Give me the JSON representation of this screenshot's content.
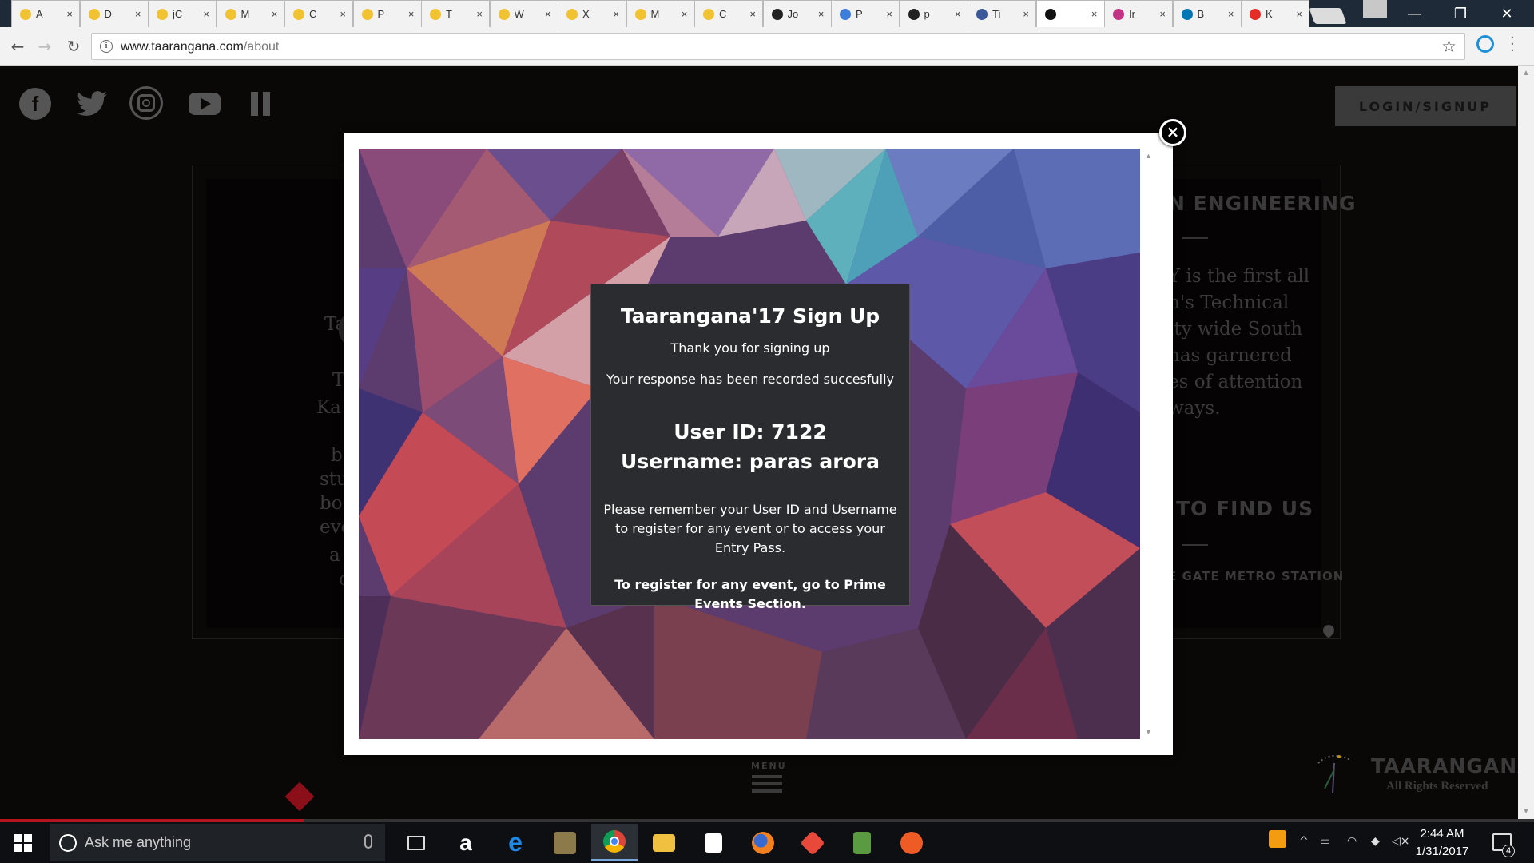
{
  "browser": {
    "tabs": [
      {
        "title": "A",
        "favicon": "chrome-circle-icon",
        "color": "#f1c232"
      },
      {
        "title": "D",
        "favicon": "chrome-circle-icon",
        "color": "#f1c232"
      },
      {
        "title": "jC",
        "favicon": "chrome-circle-icon",
        "color": "#f1c232"
      },
      {
        "title": "M",
        "favicon": "chrome-circle-icon",
        "color": "#f1c232"
      },
      {
        "title": "C",
        "favicon": "chrome-circle-icon",
        "color": "#f1c232"
      },
      {
        "title": "P",
        "favicon": "chrome-circle-icon",
        "color": "#f1c232"
      },
      {
        "title": "T",
        "favicon": "chrome-circle-icon",
        "color": "#f1c232"
      },
      {
        "title": "W",
        "favicon": "chrome-circle-icon",
        "color": "#f1c232"
      },
      {
        "title": "X",
        "favicon": "chrome-circle-icon",
        "color": "#f1c232"
      },
      {
        "title": "M",
        "favicon": "chrome-circle-icon",
        "color": "#f1c232"
      },
      {
        "title": "C",
        "favicon": "chrome-circle-icon",
        "color": "#f1c232"
      },
      {
        "title": "Jo",
        "favicon": "github-icon",
        "color": "#222222"
      },
      {
        "title": "P",
        "favicon": "help-circle-icon",
        "color": "#3d7edb"
      },
      {
        "title": "p",
        "favicon": "github-icon",
        "color": "#222222"
      },
      {
        "title": "Ti",
        "favicon": "facebook-icon",
        "color": "#3b5998"
      },
      {
        "title": "",
        "favicon": "site-icon",
        "color": "#111111",
        "active": true
      },
      {
        "title": "Ir",
        "favicon": "instagram-icon",
        "color": "#c13584"
      },
      {
        "title": "B",
        "favicon": "linkedin-icon",
        "color": "#0077b5"
      },
      {
        "title": "K",
        "favicon": "youtube-icon",
        "color": "#e52d27"
      }
    ],
    "tab_close": "×",
    "url_domain": "www.taarangana.com",
    "url_path": "/about"
  },
  "page": {
    "login_label": "LOGIN/SIGNUP",
    "bg_left_lines": [
      "Ta",
      "T",
      "Ka",
      "b",
      "stu",
      "bo",
      "eve",
      "a",
      "c"
    ],
    "bg_right_heading": "N ENGINEERING",
    "bg_right_text": [
      "Y is the first all",
      "n's Technical",
      "ity wide South",
      "has garnered",
      "es of attention",
      "ways."
    ],
    "bg_find_heading": "TO FIND US",
    "bg_metro": "E GATE METRO STATION",
    "menu_label": "MENU",
    "brand_name": "TAARANGANA",
    "brand_sub": "All Rights Reserved"
  },
  "modal": {
    "close_label": "×",
    "title": "Taarangana'17 Sign Up",
    "thanks": "Thank you for signing up",
    "recorded": "Your response has been recorded succesfully",
    "user_id": "User ID: 7122",
    "username": "Username: paras arora",
    "note": "Please remember your User ID and Username to register for any event or to access your Entry Pass.",
    "register_note": "To register for any event, go to Prime Events Section."
  },
  "taskbar": {
    "search_placeholder": "Ask me anything",
    "time": "2:44 AM",
    "date": "1/31/2017",
    "notification_count": "4"
  }
}
